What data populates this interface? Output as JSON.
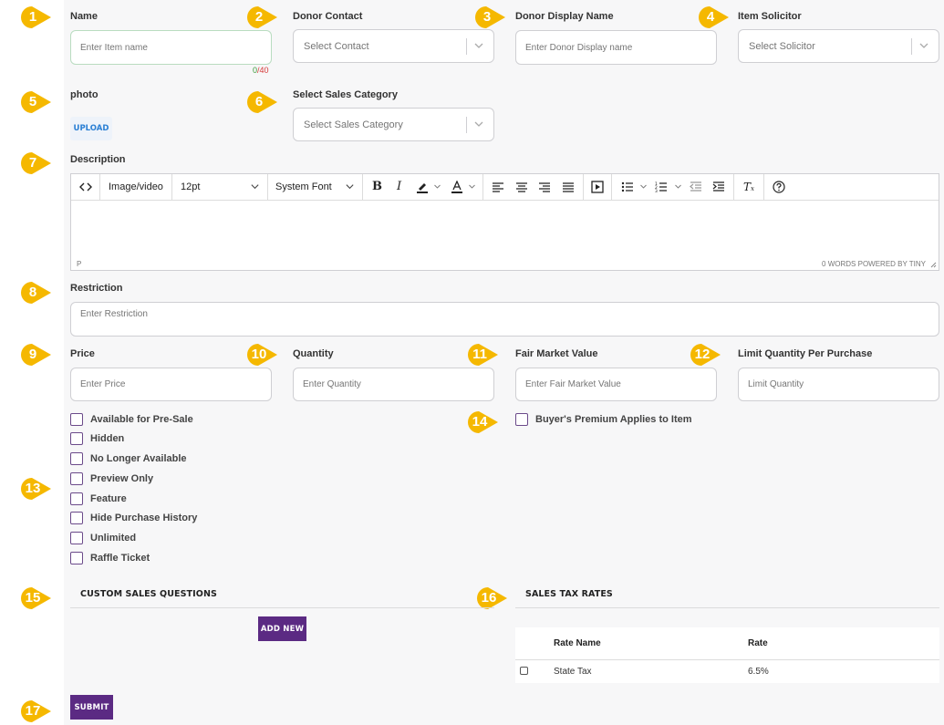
{
  "fields": {
    "name": {
      "label": "Name",
      "placeholder": "Enter Item name",
      "count_current": "0",
      "count_max": "/40"
    },
    "donor_contact": {
      "label": "Donor Contact",
      "placeholder": "Select Contact"
    },
    "donor_display": {
      "label": "Donor Display Name",
      "placeholder": "Enter Donor Display name"
    },
    "solicitor": {
      "label": "Item Solicitor",
      "placeholder": "Select Solicitor"
    },
    "photo": {
      "label": "photo",
      "button": "UPLOAD"
    },
    "sales_category": {
      "label": "Select Sales Category",
      "placeholder": "Select Sales Category"
    },
    "description": {
      "label": "Description"
    },
    "restriction": {
      "label": "Restriction",
      "placeholder": "Enter Restriction"
    },
    "price": {
      "label": "Price",
      "placeholder": "Enter Price"
    },
    "quantity": {
      "label": "Quantity",
      "placeholder": "Enter Quantity"
    },
    "fair_market": {
      "label": "Fair Market Value",
      "placeholder": "Enter Fair Market Value"
    },
    "limit_qty": {
      "label": "Limit Quantity Per Purchase",
      "placeholder": "Limit Quantity"
    }
  },
  "editor": {
    "image_video": "Image/video",
    "font_size": "12pt",
    "font_family": "System Font",
    "status_path": "P",
    "status_right": "0 WORDS  POWERED BY TINY"
  },
  "checkboxes": [
    {
      "label": "Available for Pre-Sale",
      "checked": false
    },
    {
      "label": "Hidden",
      "checked": false
    },
    {
      "label": "No Longer Available",
      "checked": false
    },
    {
      "label": "Preview Only",
      "checked": false
    },
    {
      "label": "Feature",
      "checked": false
    },
    {
      "label": "Hide Purchase History",
      "checked": false
    },
    {
      "label": "Unlimited",
      "checked": false
    },
    {
      "label": "Raffle Ticket",
      "checked": false
    }
  ],
  "buyers_premium": {
    "label": "Buyer's Premium Applies to Item",
    "checked": false
  },
  "custom_questions": {
    "title": "CUSTOM SALES QUESTIONS",
    "add_button": "ADD NEW"
  },
  "tax_rates": {
    "title": "SALES TAX RATES",
    "columns": [
      "Rate Name",
      "Rate"
    ],
    "rows": [
      {
        "name": "State Tax",
        "rate": "6.5%",
        "checked": false
      }
    ]
  },
  "submit_label": "SUBMIT",
  "markers": [
    "1",
    "2",
    "3",
    "4",
    "5",
    "6",
    "7",
    "8",
    "9",
    "10",
    "11",
    "12",
    "13",
    "14",
    "15",
    "16",
    "17"
  ],
  "colors": {
    "marker": "#f5b800",
    "primary_button": "#5b2a83",
    "link_blue": "#2a7fd4",
    "counter_green": "#3a9a3a",
    "counter_red": "#d63a3a"
  }
}
